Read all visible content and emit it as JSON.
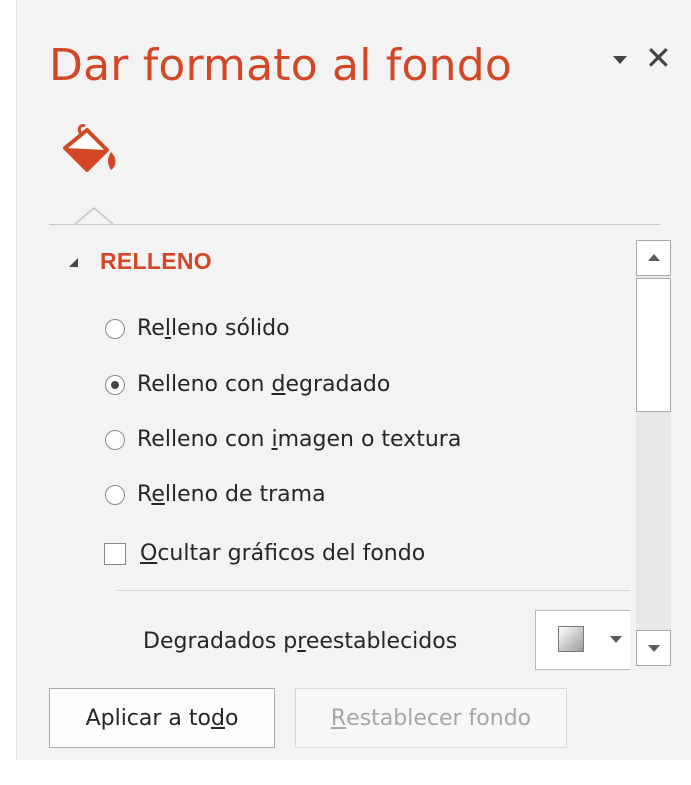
{
  "pane": {
    "title": "Dar formato al fondo",
    "menu_icon": "chevron-down-icon",
    "close_icon": "close-icon",
    "close_glyph": "✕",
    "tab_icon": "paint-bucket-icon"
  },
  "fill_section": {
    "title": "RELLENO",
    "options": [
      {
        "pre": "Re",
        "key": "l",
        "post": "leno sólido",
        "checked": false
      },
      {
        "pre": "Relleno con ",
        "key": "d",
        "post": "egradado",
        "checked": true
      },
      {
        "pre": "Relleno con ",
        "key": "i",
        "post": "magen o textura",
        "checked": false
      },
      {
        "pre": "R",
        "key": "e",
        "post": "lleno de trama",
        "checked": false
      }
    ],
    "hide_graphics": {
      "pre": "",
      "key": "O",
      "post": "cultar gráficos del fondo",
      "checked": false
    },
    "presets": {
      "pre": "Degradados p",
      "key": "r",
      "post": "eestablecidos"
    }
  },
  "footer": {
    "apply": {
      "pre": "Aplicar a to",
      "key": "d",
      "post": "o"
    },
    "reset": {
      "pre": "",
      "key": "R",
      "post": "establecer fondo",
      "enabled": false
    }
  },
  "colors": {
    "accent": "#d24726",
    "pane_bg": "#f3f3f3",
    "text": "#262626",
    "disabled_text": "#a6a6a6"
  }
}
